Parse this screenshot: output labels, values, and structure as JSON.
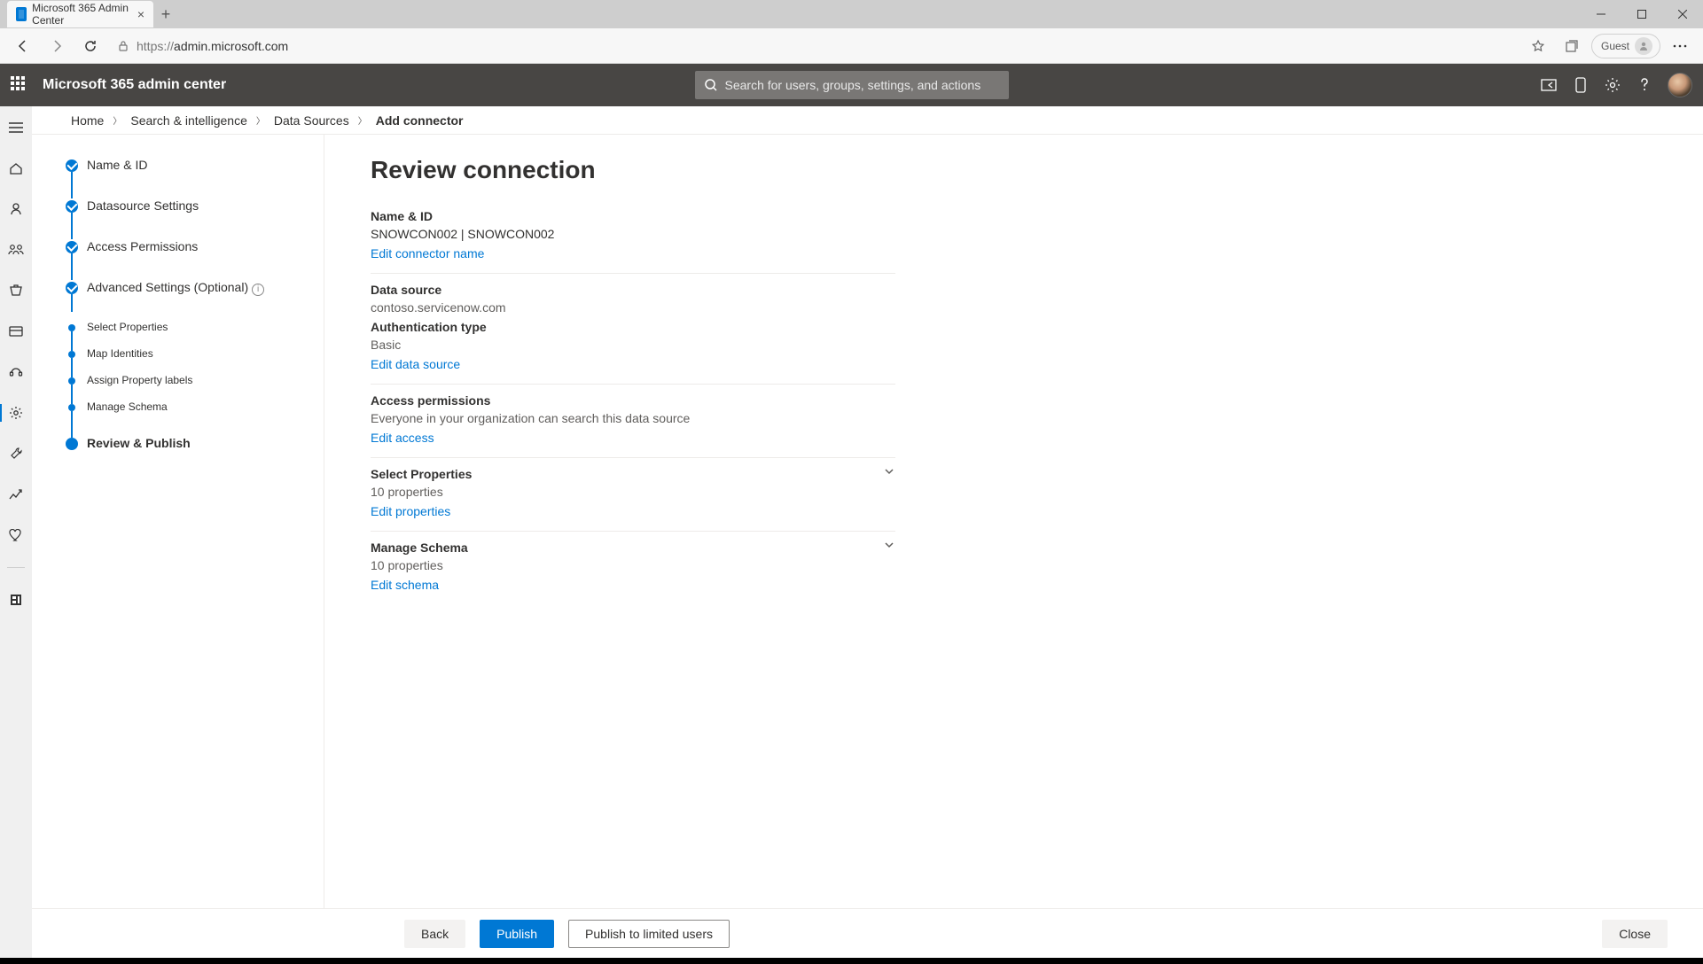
{
  "browser": {
    "tab_title": "Microsoft 365 Admin Center",
    "url_prefix": "https://",
    "url_host": "admin.microsoft.com",
    "guest_label": "Guest"
  },
  "header": {
    "suite_title": "Microsoft 365 admin center",
    "search_placeholder": "Search for users, groups, settings, and actions"
  },
  "breadcrumb": {
    "home": "Home",
    "search": "Search & intelligence",
    "datasources": "Data Sources",
    "add": "Add connector"
  },
  "wizard": {
    "steps": {
      "name_id": "Name & ID",
      "datasource": "Datasource Settings",
      "access": "Access Permissions",
      "advanced": "Advanced Settings (Optional)",
      "select_props": "Select Properties",
      "map_identities": "Map Identities",
      "assign_labels": "Assign Property labels",
      "manage_schema": "Manage Schema",
      "review": "Review & Publish"
    }
  },
  "review": {
    "title": "Review connection",
    "name_id": {
      "label": "Name & ID",
      "value": "SNOWCON002 | SNOWCON002",
      "link": "Edit connector name"
    },
    "datasource": {
      "label": "Data source",
      "value": "contoso.servicenow.com",
      "auth_label": "Authentication type",
      "auth_value": "Basic",
      "link": "Edit data source"
    },
    "access": {
      "label": "Access permissions",
      "value": "Everyone in your organization can search this data source",
      "link": "Edit access"
    },
    "select_props": {
      "label": "Select Properties",
      "value": "10 properties",
      "link": "Edit properties"
    },
    "schema": {
      "label": "Manage Schema",
      "value": "10 properties",
      "link": "Edit schema"
    }
  },
  "footer": {
    "back": "Back",
    "publish": "Publish",
    "publish_limited": "Publish to limited users",
    "close": "Close"
  }
}
